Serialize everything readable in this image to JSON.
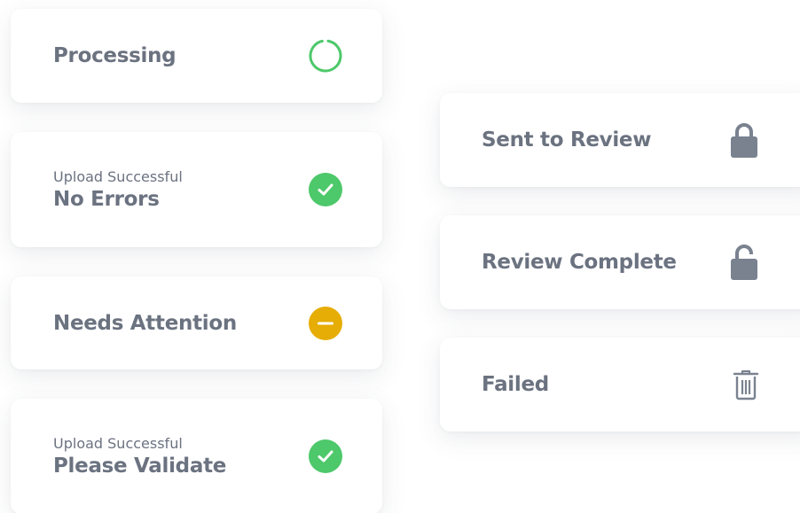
{
  "colors": {
    "text": "#6b7280",
    "success": "#4dc86a",
    "warning": "#e6ad06",
    "neutral_icon": "#7a8290"
  },
  "left_cards": [
    {
      "title": "Processing",
      "icon": "progress-ring-icon"
    },
    {
      "subtitle": "Upload Successful",
      "title": "No Errors",
      "icon": "check-circle-icon"
    },
    {
      "title": "Needs Attention",
      "icon": "minus-circle-icon"
    },
    {
      "subtitle": "Upload Successful",
      "title": "Please Validate",
      "icon": "check-circle-icon"
    }
  ],
  "right_cards": [
    {
      "title": "Sent to Review",
      "icon": "lock-closed-icon"
    },
    {
      "title": "Review Complete",
      "icon": "lock-open-icon"
    },
    {
      "title": "Failed",
      "icon": "trash-icon"
    }
  ]
}
